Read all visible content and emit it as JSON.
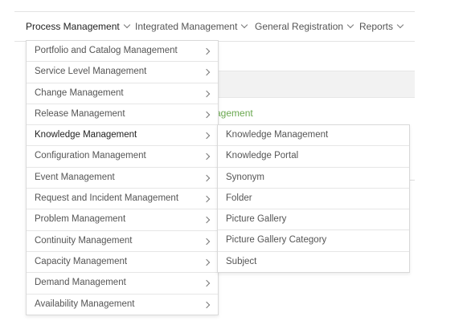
{
  "navbar": {
    "items": [
      {
        "label": "Process Management"
      },
      {
        "label": "Integrated Management"
      },
      {
        "label": "General Registration"
      },
      {
        "label": "Reports"
      }
    ]
  },
  "background": {
    "link_text": "agement"
  },
  "menu": {
    "items": [
      {
        "label": "Portfolio and Catalog Management"
      },
      {
        "label": "Service Level Management"
      },
      {
        "label": "Change Management"
      },
      {
        "label": "Release Management"
      },
      {
        "label": "Knowledge Management"
      },
      {
        "label": "Configuration Management"
      },
      {
        "label": "Event Management"
      },
      {
        "label": "Request and Incident Management"
      },
      {
        "label": "Problem Management"
      },
      {
        "label": "Continuity Management"
      },
      {
        "label": "Capacity Management"
      },
      {
        "label": "Demand Management"
      },
      {
        "label": "Availability Management"
      }
    ]
  },
  "submenu": {
    "items": [
      {
        "label": "Knowledge Management"
      },
      {
        "label": "Knowledge Portal"
      },
      {
        "label": "Synonym"
      },
      {
        "label": "Folder"
      },
      {
        "label": "Picture Gallery"
      },
      {
        "label": "Picture Gallery Category"
      },
      {
        "label": "Subject"
      }
    ]
  },
  "colors": {
    "link_green": "#6aa84f",
    "border": "#d9d9d9",
    "text": "#555555"
  }
}
